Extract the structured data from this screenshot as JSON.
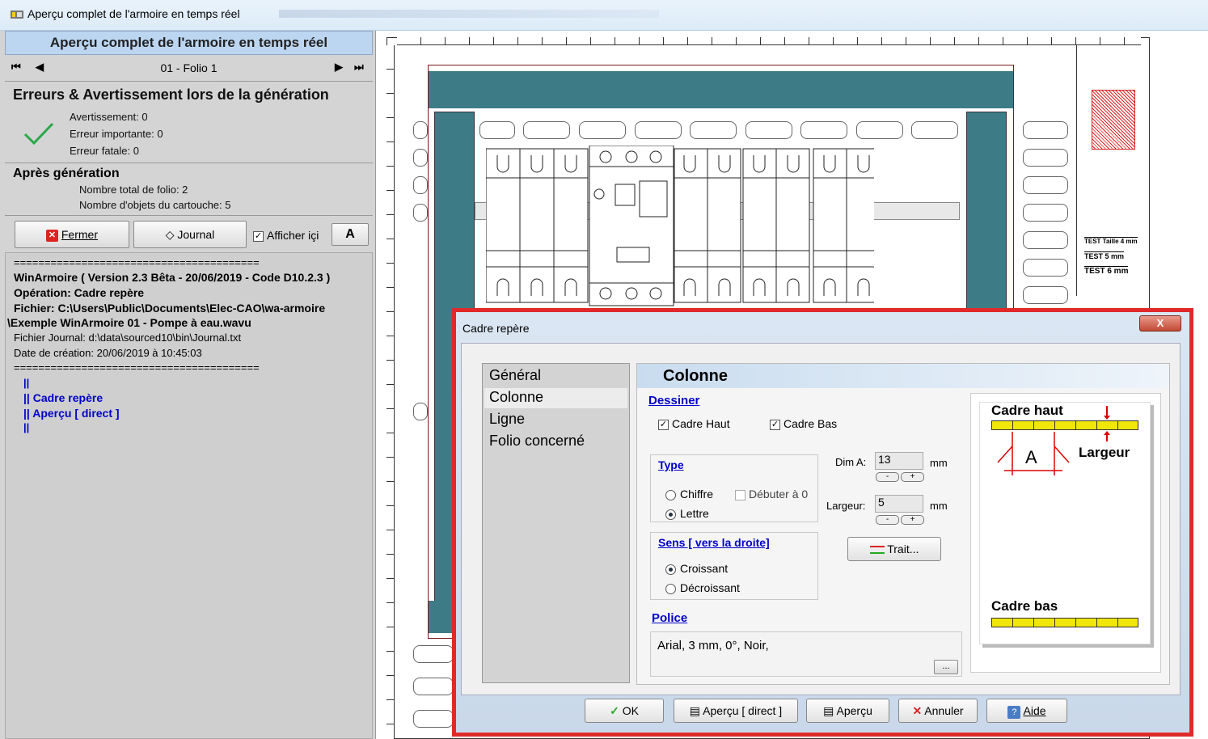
{
  "window": {
    "title": "Aperçu complet de l'armoire en temps réel"
  },
  "panel": {
    "header": "Aperçu complet de l'armoire en temps réel",
    "nav": {
      "first": "⏮",
      "prev": "◀",
      "folio": "01 - Folio 1",
      "next": "▶",
      "last": "⏭"
    },
    "errors": {
      "title": "Erreurs & Avertissement lors de la génération",
      "warning": "Avertissement: 0",
      "major": "Erreur importante: 0",
      "fatal": "Erreur fatale: 0"
    },
    "after": {
      "title": "Après génération",
      "folios": "Nombre total de folio: 2",
      "objects": "Nombre d'objets du cartouche: 5"
    },
    "buttons": {
      "close": "Fermer",
      "journal": "Journal",
      "show_here": "Afficher içi",
      "font": "A"
    },
    "log": [
      "========================================",
      "WinArmoire ( Version 2.3 Bêta  - 20/06/2019 - Code D10.2.3 )",
      "Opération: Cadre repère",
      "Fichier: C:\\Users\\Public\\Documents\\Elec-CAO\\wa-armoire",
      "\\Exemple WinArmoire 01 - Pompe à eau.wavu",
      "Fichier Journal: d:\\data\\sourced10\\bin\\Journal.txt",
      "Date de création: 20/06/2019 à 10:45:03",
      "========================================"
    ],
    "log_links": [
      "||",
      "|| Cadre repère",
      "|| Aperçu [ direct ]",
      "||"
    ]
  },
  "drawing": {
    "labels": [
      "TEST Taille 4 mm",
      "TEST 5 mm",
      "TEST 6 mm"
    ]
  },
  "dialog": {
    "title": "Cadre repère",
    "close": "X",
    "tabs": [
      "Général",
      "Colonne",
      "Ligne",
      "Folio concerné"
    ],
    "section": "Colonne",
    "draw": {
      "label": "Dessiner",
      "top": "Cadre Haut",
      "bottom": "Cadre Bas"
    },
    "type": {
      "label": "Type",
      "digit": "Chiffre",
      "start0": "Débuter à 0",
      "letter": "Lettre"
    },
    "dims": {
      "dima_label": "Dim A:",
      "dima": "13",
      "width_label": "Largeur:",
      "width": "5",
      "unit": "mm"
    },
    "sens": {
      "label": "Sens [ vers la droite]",
      "asc": "Croissant",
      "desc": "Décroissant"
    },
    "trait": "Trait...",
    "police": {
      "label": "Police",
      "value": "Arial, 3 mm, 0°, Noir,",
      "more": "..."
    },
    "preview": {
      "top": "Cadre haut",
      "bottom": "Cadre bas",
      "a": "A",
      "width": "Largeur"
    },
    "buttons": {
      "ok": "OK",
      "preview_direct": "Aperçu [ direct ]",
      "preview": "Aperçu",
      "cancel": "Annuler",
      "help": "Aide"
    }
  }
}
